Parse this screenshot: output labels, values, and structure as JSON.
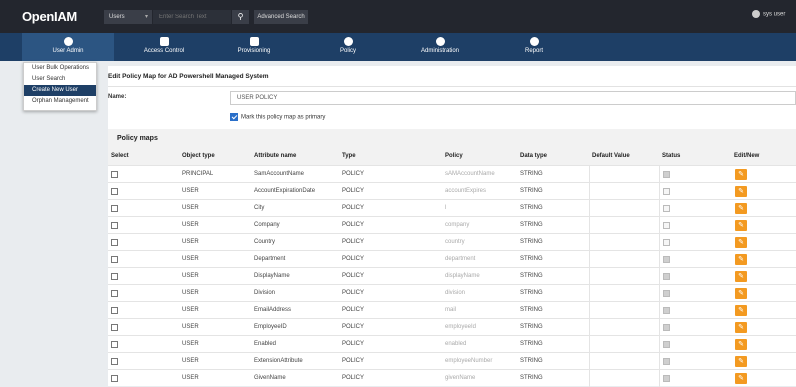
{
  "app": {
    "logo": "OpenIAM"
  },
  "search": {
    "type": "Users",
    "placeholder": "Enter Search Text",
    "advanced_label": "Advanced Search"
  },
  "user": {
    "name": "sys user"
  },
  "nav": [
    {
      "label": "User Admin",
      "icon": "user-icon"
    },
    {
      "label": "Access Control",
      "icon": "access-icon"
    },
    {
      "label": "Provisioning",
      "icon": "provisioning-icon"
    },
    {
      "label": "Policy",
      "icon": "policy-icon"
    },
    {
      "label": "Administration",
      "icon": "gear-icon"
    },
    {
      "label": "Report",
      "icon": "report-icon"
    }
  ],
  "menu": [
    "User Bulk Operations",
    "User Search",
    "Create New User",
    "Orphan Management"
  ],
  "form": {
    "title": "Edit Policy Map for AD Powershell Managed System",
    "name_label": "Name:",
    "name_value": "USER POLICY",
    "primary_label": "Mark this policy map as primary"
  },
  "policy_maps": {
    "title": "Policy maps",
    "columns": [
      "Select",
      "Object type",
      "Attribute name",
      "Type",
      "Policy",
      "Data type",
      "Default Value",
      "Status",
      "Edit/New"
    ],
    "rows": [
      {
        "obj": "PRINCIPAL",
        "attr": "SamAccountName",
        "type": "POLICY",
        "policy": "sAMAccountName",
        "dtype": "STRING",
        "status": true
      },
      {
        "obj": "USER",
        "attr": "AccountExpirationDate",
        "type": "POLICY",
        "policy": "accountExpires",
        "dtype": "STRING",
        "status": false
      },
      {
        "obj": "USER",
        "attr": "City",
        "type": "POLICY",
        "policy": "l",
        "dtype": "STRING",
        "status": false
      },
      {
        "obj": "USER",
        "attr": "Company",
        "type": "POLICY",
        "policy": "company",
        "dtype": "STRING",
        "status": false
      },
      {
        "obj": "USER",
        "attr": "Country",
        "type": "POLICY",
        "policy": "country",
        "dtype": "STRING",
        "status": false
      },
      {
        "obj": "USER",
        "attr": "Department",
        "type": "POLICY",
        "policy": "department",
        "dtype": "STRING",
        "status": true
      },
      {
        "obj": "USER",
        "attr": "DisplayName",
        "type": "POLICY",
        "policy": "displayName",
        "dtype": "STRING",
        "status": true
      },
      {
        "obj": "USER",
        "attr": "Division",
        "type": "POLICY",
        "policy": "division",
        "dtype": "STRING",
        "status": true
      },
      {
        "obj": "USER",
        "attr": "EmailAddress",
        "type": "POLICY",
        "policy": "mail",
        "dtype": "STRING",
        "status": true
      },
      {
        "obj": "USER",
        "attr": "EmployeeID",
        "type": "POLICY",
        "policy": "employeeId",
        "dtype": "STRING",
        "status": true
      },
      {
        "obj": "USER",
        "attr": "Enabled",
        "type": "POLICY",
        "policy": "enabled",
        "dtype": "STRING",
        "status": true
      },
      {
        "obj": "USER",
        "attr": "ExtensionAttribute",
        "type": "POLICY",
        "policy": "employeeNumber",
        "dtype": "STRING",
        "status": true
      },
      {
        "obj": "USER",
        "attr": "GivenName",
        "type": "POLICY",
        "policy": "givenName",
        "dtype": "STRING",
        "status": true
      }
    ]
  },
  "colors": {
    "topbar": "#23262e",
    "navbar": "#1e3f66",
    "edit": "#f39a21"
  }
}
